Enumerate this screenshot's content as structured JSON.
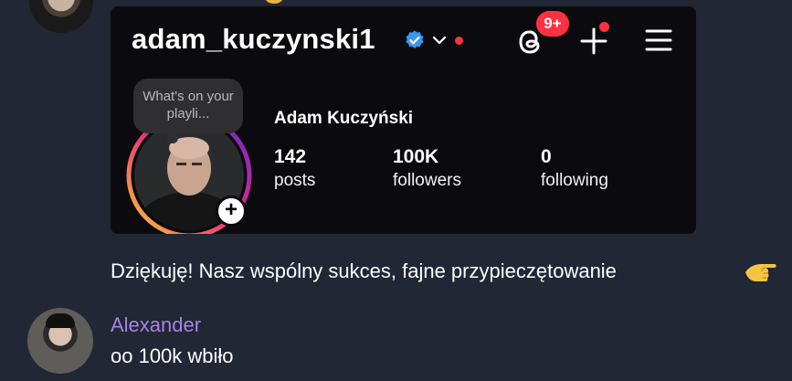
{
  "colors": {
    "background": "#212734",
    "card": "#0b0b0f",
    "accent_red": "#ff3040",
    "sender_purple": "#a483e6",
    "verified_blue": "#3897f0"
  },
  "instagram": {
    "username": "adam_kuczynski1",
    "notification_badge": "9+",
    "note_text": "What's on your playli...",
    "display_name": "Adam Kuczyński",
    "stats": [
      {
        "value": "142",
        "label": "posts"
      },
      {
        "value": "100K",
        "label": "followers"
      },
      {
        "value": "0",
        "label": "following"
      }
    ],
    "add_story_symbol": "+",
    "icons": [
      "verified-badge-icon",
      "chevron-down-icon",
      "threads-icon",
      "plus-icon",
      "menu-icon"
    ]
  },
  "messages": [
    {
      "text": "Dziękuję! Nasz wspólny sukces, fajne przypieczętowanie",
      "emoji": "pointing-hand-emoji"
    },
    {
      "sender": "Alexander",
      "text": "oo 100k wbiło"
    }
  ]
}
